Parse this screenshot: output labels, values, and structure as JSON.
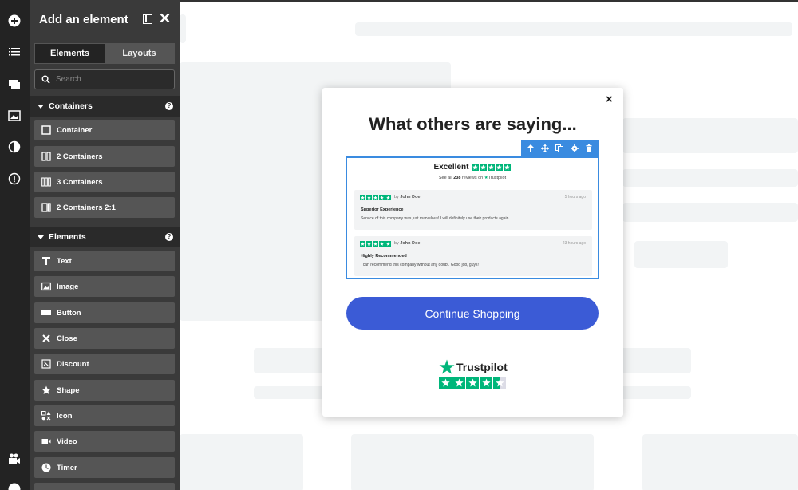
{
  "panel": {
    "title": "Add an element",
    "tabs": [
      {
        "label": "Elements",
        "active": true
      },
      {
        "label": "Layouts",
        "active": false
      }
    ],
    "search_placeholder": "Search",
    "sections": [
      {
        "label": "Containers",
        "help": "?",
        "items": [
          {
            "label": "Container",
            "icon": "square-icon"
          },
          {
            "label": "2 Containers",
            "icon": "two-columns-icon"
          },
          {
            "label": "3 Containers",
            "icon": "three-columns-icon"
          },
          {
            "label": "2 Containers 2:1",
            "icon": "two-one-columns-icon"
          }
        ]
      },
      {
        "label": "Elements",
        "help": "?",
        "items": [
          {
            "label": "Text",
            "icon": "text-icon"
          },
          {
            "label": "Image",
            "icon": "image-icon"
          },
          {
            "label": "Button",
            "icon": "button-icon"
          },
          {
            "label": "Close",
            "icon": "close-icon"
          },
          {
            "label": "Discount",
            "icon": "discount-icon"
          },
          {
            "label": "Shape",
            "icon": "star-icon"
          },
          {
            "label": "Icon",
            "icon": "icons-icon"
          },
          {
            "label": "Video",
            "icon": "video-icon"
          },
          {
            "label": "Timer",
            "icon": "clock-icon"
          }
        ]
      }
    ]
  },
  "modal": {
    "close": "×",
    "title": "What others are saying...",
    "widget": {
      "excellent": "Excellent",
      "summary_prefix": "See all",
      "summary_count": "238",
      "summary_suffix": "reviews on",
      "summary_brand": "Trustpilot",
      "reviews": [
        {
          "author_prefix": "by",
          "author": "John Doe",
          "time": "5 hours ago",
          "title": "Superior Experience",
          "text": "Service of this company was just marvelous! I will definitely use their products again."
        },
        {
          "author_prefix": "by",
          "author": "John Doe",
          "time": "23 hours ago",
          "title": "Highly Recommended",
          "text": "I can recommend this company without any doubt. Good job, guys!"
        }
      ]
    },
    "cta_label": "Continue Shopping",
    "brand": "Trustpilot",
    "rating": 4.5
  },
  "colors": {
    "accent": "#3a8be0",
    "cta": "#3b5bd6",
    "trustpilot_green": "#00b67a",
    "panel_bg": "#3a3a3a",
    "rail_bg": "#232323"
  }
}
